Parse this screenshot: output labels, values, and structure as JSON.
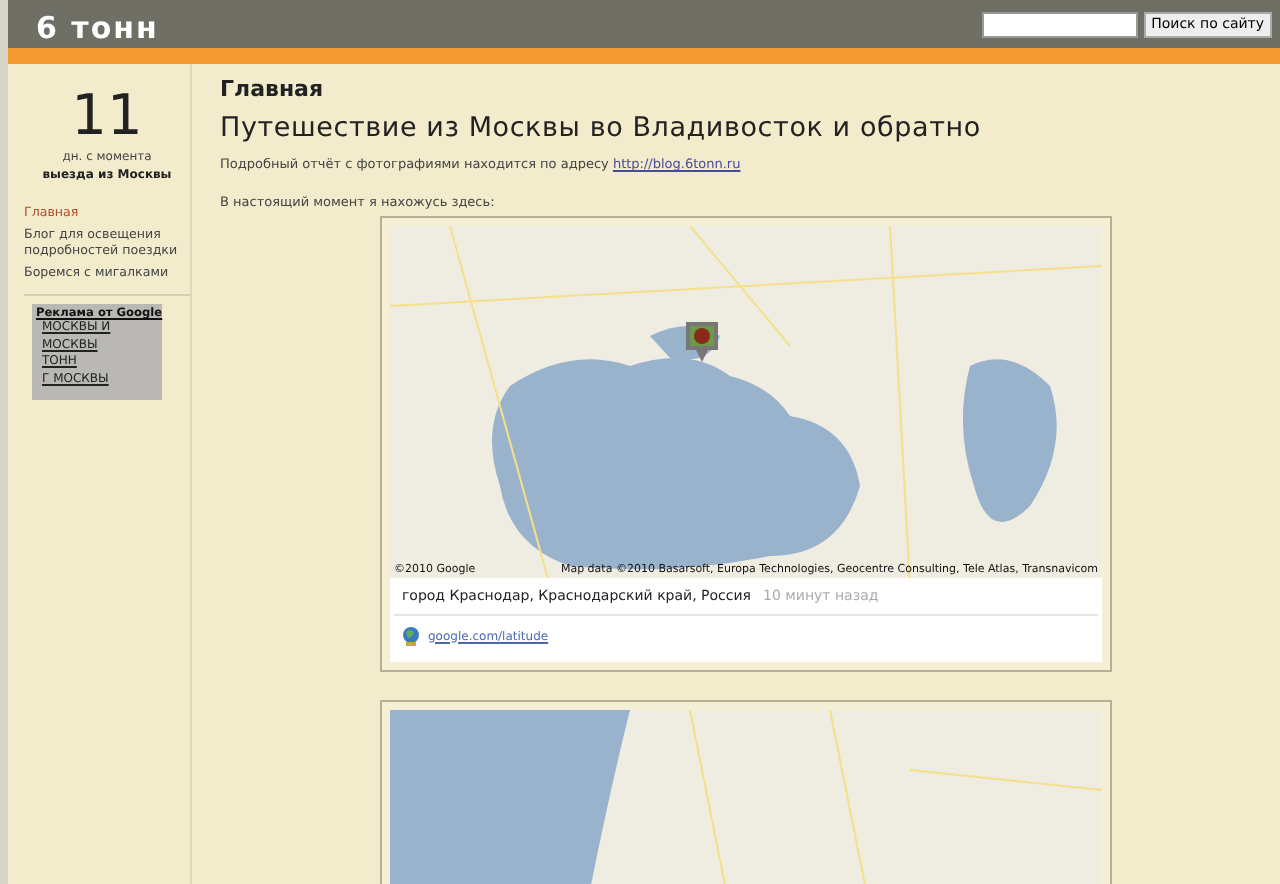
{
  "header": {
    "site_title": "6 тонн",
    "search": {
      "button": "Поиск по сайту"
    }
  },
  "sidebar": {
    "counter": {
      "number": "11",
      "caption": "дн. с момента",
      "subcaption": "выезда из Москвы"
    },
    "nav": [
      {
        "label": "Главная",
        "selected": true
      },
      {
        "label": "Блог для освещения подробностей поездки",
        "selected": false
      },
      {
        "label": "Боремся с мигалками",
        "selected": false
      }
    ],
    "ads": {
      "title": "Реклама от Google",
      "links": [
        "МОСКВЫ И",
        "МОСКВЫ",
        "ТОНН",
        "Г МОСКВЫ"
      ]
    }
  },
  "main": {
    "breadcrumb": "Главная",
    "title": "Путешествие из Москвы во Владивосток и обратно",
    "report_text": "Подробный отчёт с фотографиями находится по адресу",
    "report_link": "http://blog.6tonn.ru",
    "location_intro": "В настоящий момент я нахожусь здесь:",
    "cards": [
      {
        "kind": "full",
        "map_copyright": "©2010 Google",
        "map_data": "Map data ©2010 Basarsoft, Europa Technologies, Geocentre Consulting, Tele Atlas, Transnavicom",
        "place": "город Краснодар, Краснодарский край, Россия",
        "time": "10 минут назад",
        "source_link": "google.com/latitude"
      },
      {
        "kind": "partial"
      }
    ]
  }
}
